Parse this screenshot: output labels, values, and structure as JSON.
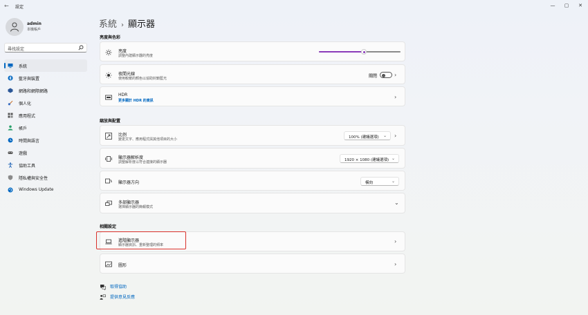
{
  "window": {
    "title": "設定"
  },
  "profile": {
    "name": "admin",
    "account_type": "本機帳戶"
  },
  "search": {
    "placeholder": "尋找設定"
  },
  "sidebar": {
    "items": [
      {
        "label": "系統",
        "icon": "monitor-icon",
        "color": "#0067c0"
      },
      {
        "label": "藍牙與裝置",
        "icon": "bluetooth-icon",
        "color": "#0067c0"
      },
      {
        "label": "網路和網際網路",
        "icon": "network-icon",
        "color": "#2b5797"
      },
      {
        "label": "個人化",
        "icon": "brush-icon",
        "color": "#c76b1f"
      },
      {
        "label": "應用程式",
        "icon": "apps-icon",
        "color": "#555555"
      },
      {
        "label": "帳戶",
        "icon": "person-icon",
        "color": "#2aa06b"
      },
      {
        "label": "時間與語言",
        "icon": "globe-clock-icon",
        "color": "#0067c0"
      },
      {
        "label": "遊戲",
        "icon": "gamepad-icon",
        "color": "#555555"
      },
      {
        "label": "協助工具",
        "icon": "accessibility-icon",
        "color": "#1a5fb4"
      },
      {
        "label": "隱私權與安全性",
        "icon": "shield-icon",
        "color": "#777777"
      },
      {
        "label": "Windows Update",
        "icon": "update-icon",
        "color": "#0067c0"
      }
    ]
  },
  "breadcrumb": {
    "parent": "系統",
    "separator": "›",
    "current": "顯示器"
  },
  "sections": {
    "brightness_color": "亮度與色彩",
    "scale_layout": "縮放與配置",
    "related": "相關設定"
  },
  "brightness": {
    "title": "亮度",
    "subtitle": "調整內建顯示器的亮度",
    "value": 0.55
  },
  "night_light": {
    "title": "夜間光線",
    "subtitle": "使用較暖的顏色以協助封鎖藍光",
    "state": "關閉"
  },
  "hdr": {
    "title": "HDR",
    "link": "更多關於 HDR 的資訊"
  },
  "scale": {
    "title": "比例",
    "subtitle": "變更文字、應用程式與其他項目的大小",
    "value": "100% (建議選項)"
  },
  "resolution": {
    "title": "顯示器解析度",
    "subtitle": "調整解析度以符合連接的顯示器",
    "value": "1920 × 1080 (建議選項)"
  },
  "orientation": {
    "title": "顯示器方向",
    "value": "橫向"
  },
  "multiple": {
    "title": "多部顯示器",
    "subtitle": "選擇顯示器的簡報模式"
  },
  "advanced": {
    "title": "進階顯示器",
    "subtitle": "顯示器資訊、重新整理的頻率"
  },
  "graphics": {
    "title": "圖形"
  },
  "footer": {
    "help": "取得協助",
    "feedback": "提供意見反應"
  },
  "colors": {
    "accent": "#0067c0",
    "slider": "#8a3ab9",
    "highlight": "#d9302a"
  }
}
